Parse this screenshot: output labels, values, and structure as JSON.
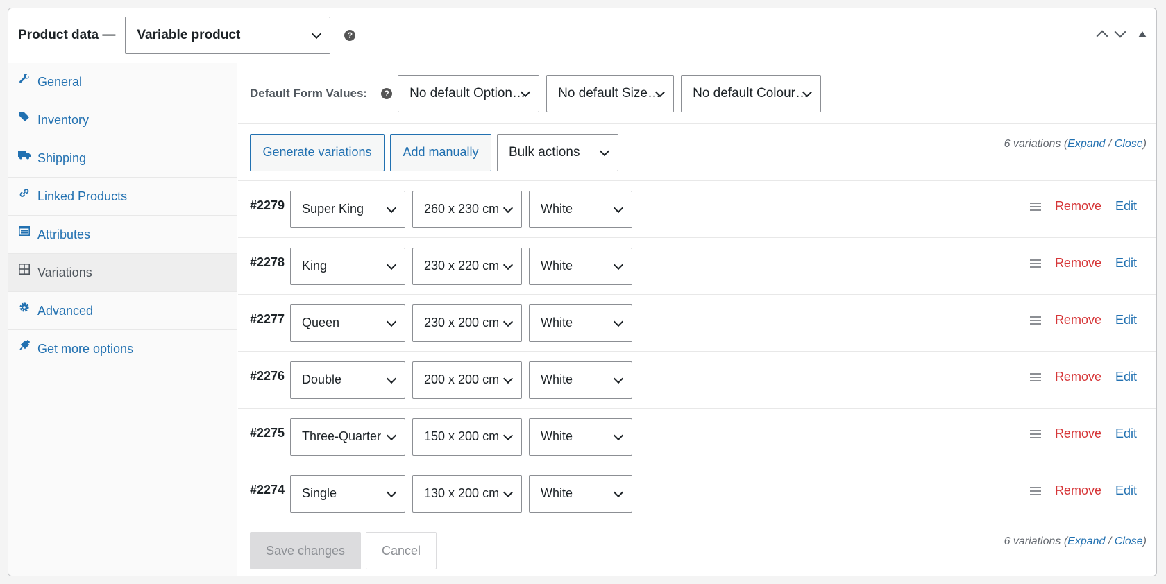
{
  "header": {
    "title": "Product data —",
    "product_type": "Variable product"
  },
  "sidebar": {
    "tabs": [
      {
        "label": "General",
        "icon": "wrench-icon"
      },
      {
        "label": "Inventory",
        "icon": "tag-icon"
      },
      {
        "label": "Shipping",
        "icon": "truck-icon"
      },
      {
        "label": "Linked Products",
        "icon": "link-icon"
      },
      {
        "label": "Attributes",
        "icon": "list-icon"
      },
      {
        "label": "Variations",
        "icon": "grid-icon"
      },
      {
        "label": "Advanced",
        "icon": "gear-icon"
      },
      {
        "label": "Get more options",
        "icon": "plugin-icon"
      }
    ],
    "active": "Variations"
  },
  "defaults": {
    "label": "Default Form Values:",
    "option": "No default Option…",
    "size": "No default Size…",
    "colour": "No default Colour…"
  },
  "actions": {
    "generate": "Generate variations",
    "add_manually": "Add manually",
    "bulk_actions": "Bulk actions",
    "count_text": "6 variations (",
    "expand": "Expand",
    "sep": " / ",
    "close": "Close",
    "count_end": ")"
  },
  "variations": [
    {
      "id": "#2279",
      "option": "Super King",
      "size": "260 x 230 cm",
      "colour": "White"
    },
    {
      "id": "#2278",
      "option": "King",
      "size": "230 x 220 cm",
      "colour": "White"
    },
    {
      "id": "#2277",
      "option": "Queen",
      "size": "230 x 200 cm",
      "colour": "White"
    },
    {
      "id": "#2276",
      "option": "Double",
      "size": "200 x 200 cm",
      "colour": "White"
    },
    {
      "id": "#2275",
      "option": "Three-Quarter",
      "size": "150 x 200 cm",
      "colour": "White"
    },
    {
      "id": "#2274",
      "option": "Single",
      "size": "130 x 200 cm",
      "colour": "White"
    }
  ],
  "row_actions": {
    "remove": "Remove",
    "edit": "Edit"
  },
  "footer": {
    "save": "Save changes",
    "cancel": "Cancel"
  },
  "colors": {
    "link": "#2271b1",
    "remove": "#d63638"
  }
}
